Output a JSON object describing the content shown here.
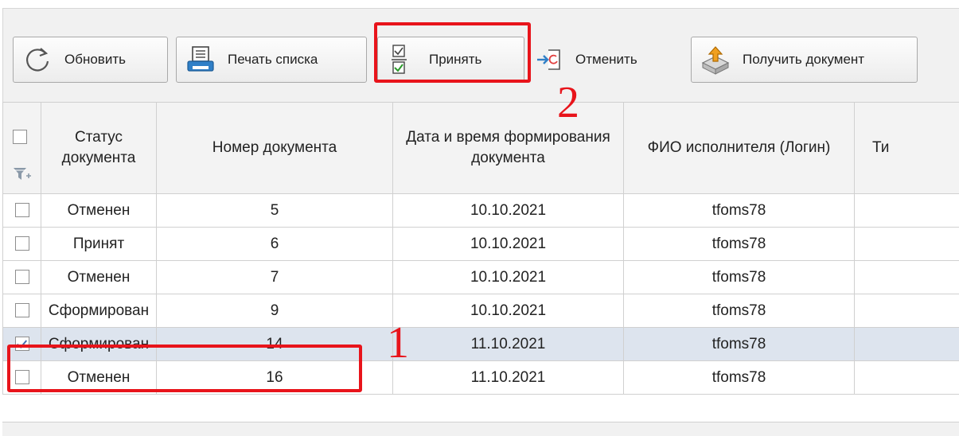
{
  "toolbar": {
    "buttons": [
      {
        "icon": "refresh-icon",
        "label": "Обновить"
      },
      {
        "icon": "print-icon",
        "label": "Печать списка"
      },
      {
        "icon": "accept-checklist-icon",
        "label": "Принять"
      },
      {
        "icon": "cancel-doc-icon",
        "label": "Отменить"
      },
      {
        "icon": "get-document-icon",
        "label": "Получить документ"
      }
    ]
  },
  "table": {
    "columns": [
      "",
      "Статус документа",
      "Номер документа",
      "Дата и время формирования документа",
      "ФИО исполнителя (Логин)",
      "Ти"
    ],
    "rows": [
      {
        "checked": false,
        "status": "Отменен",
        "number": "5",
        "date": "10.10.2021",
        "login": "tfoms78"
      },
      {
        "checked": false,
        "status": "Принят",
        "number": "6",
        "date": "10.10.2021",
        "login": "tfoms78"
      },
      {
        "checked": false,
        "status": "Отменен",
        "number": "7",
        "date": "10.10.2021",
        "login": "tfoms78"
      },
      {
        "checked": false,
        "status": "Сформирован",
        "number": "9",
        "date": "10.10.2021",
        "login": "tfoms78"
      },
      {
        "checked": true,
        "status": "Сформирован",
        "number": "14",
        "date": "11.10.2021",
        "login": "tfoms78"
      },
      {
        "checked": false,
        "status": "Отменен",
        "number": "16",
        "date": "11.10.2021",
        "login": "tfoms78"
      }
    ]
  },
  "annotations": {
    "step1": "1",
    "step2": "2",
    "color": "#e8141b"
  },
  "colors": {
    "selected_row": "#dde4ee",
    "header_bg": "#f3f3f3",
    "toolbar_bg": "#f1f1f1"
  }
}
